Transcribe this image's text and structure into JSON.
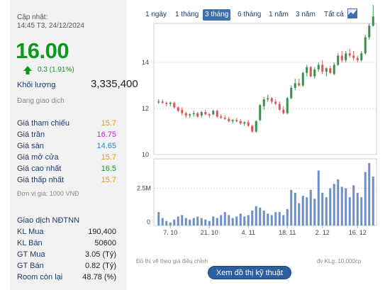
{
  "update": {
    "label": "Cập nhật:",
    "time": "14:45 T3, 24/12/2024"
  },
  "price": {
    "value": "16.00",
    "change": "0.3 (1.91%)",
    "color": "#0a9a1e"
  },
  "volume": {
    "label": "Khối lượng",
    "value": "3,335,400"
  },
  "status": "Đang giao dịch",
  "price_info": [
    {
      "label": "Giá tham chiếu",
      "value": "15.7",
      "color": "#e39a10"
    },
    {
      "label": "Giá trần",
      "value": "16.75",
      "color": "#d81ad8"
    },
    {
      "label": "Giá sàn",
      "value": "14.65",
      "color": "#1c8bd6"
    },
    {
      "label": "Giá mở cửa",
      "value": "15.7",
      "color": "#e39a10"
    },
    {
      "label": "Giá cao nhất",
      "value": "16.5",
      "color": "#0a9a1e"
    },
    {
      "label": "Giá thấp nhất",
      "value": "15.7",
      "color": "#e39a10"
    }
  ],
  "unit_note": "Đơn vị giá: 1000 VNĐ",
  "foreign": {
    "title": "Giao dịch NĐTNN",
    "rows": [
      {
        "label": "KL Mua",
        "value": "190,400"
      },
      {
        "label": "KL Bán",
        "value": "50600"
      },
      {
        "label": "GT Mua",
        "value": "3.05 (Tỷ)"
      },
      {
        "label": "GT Bán",
        "value": "0.82 (Tỷ)"
      },
      {
        "label": "Room còn lại",
        "value": "48.78 (%)"
      }
    ]
  },
  "tabs": [
    {
      "label": "1 ngày",
      "active": false
    },
    {
      "label": "1 tháng",
      "active": false
    },
    {
      "label": "3 tháng",
      "active": true
    },
    {
      "label": "6 tháng",
      "active": false
    },
    {
      "label": "1 năm",
      "active": false
    },
    {
      "label": "3 năm",
      "active": false
    },
    {
      "label": "Tất cả",
      "active": false
    }
  ],
  "chart_icon": "line-chart-icon",
  "footer": {
    "left_note": "Đồ thị vẽ theo giá điều chỉnh",
    "right_note": "đv KLg: 10,000cp",
    "button": "Xem đồ thị kỹ thuật"
  },
  "chart_data": {
    "type": "candlestick",
    "up_color": "#3a8f4d",
    "down_color": "#e05555",
    "price_axis": {
      "ticks": [
        10,
        12,
        14
      ],
      "range": [
        10,
        15.7
      ]
    },
    "volume_axis": {
      "ticks": [
        "0",
        "2.5M"
      ],
      "range": [
        0,
        4.2
      ]
    },
    "x_ticks": [
      "7. 10",
      "21. 10",
      "4. 11",
      "18. 11",
      "2. 12",
      "16. 12"
    ],
    "candles": [
      [
        12.3,
        12.4,
        12.2,
        12.3,
        0.9
      ],
      [
        12.3,
        12.4,
        12.2,
        12.25,
        0.5
      ],
      [
        12.25,
        12.3,
        12.1,
        12.2,
        0.3
      ],
      [
        12.2,
        12.3,
        12.1,
        12.25,
        0.2
      ],
      [
        12.25,
        12.3,
        12.0,
        12.05,
        0.4
      ],
      [
        12.05,
        12.1,
        11.85,
        11.9,
        0.6
      ],
      [
        11.95,
        12.05,
        11.7,
        11.8,
        0.7
      ],
      [
        11.8,
        11.85,
        11.6,
        11.7,
        0.5
      ],
      [
        11.7,
        11.8,
        11.6,
        11.75,
        0.4
      ],
      [
        11.75,
        11.9,
        11.65,
        11.8,
        0.5
      ],
      [
        11.8,
        11.85,
        11.6,
        11.65,
        0.6
      ],
      [
        11.7,
        11.9,
        11.6,
        11.85,
        0.5
      ],
      [
        11.85,
        11.95,
        11.7,
        11.75,
        0.4
      ],
      [
        11.75,
        11.8,
        11.6,
        11.7,
        0.3
      ],
      [
        11.75,
        11.95,
        11.7,
        11.9,
        0.6
      ],
      [
        11.9,
        11.95,
        11.6,
        11.65,
        0.5
      ],
      [
        11.65,
        11.75,
        11.55,
        11.6,
        0.7
      ],
      [
        11.6,
        11.7,
        11.5,
        11.55,
        0.9
      ],
      [
        11.55,
        11.65,
        11.4,
        11.45,
        0.7
      ],
      [
        11.45,
        11.55,
        11.35,
        11.5,
        0.5
      ],
      [
        11.5,
        11.6,
        11.4,
        11.45,
        0.6
      ],
      [
        11.45,
        11.55,
        11.3,
        11.35,
        0.8
      ],
      [
        11.35,
        11.45,
        11.25,
        11.4,
        0.6
      ],
      [
        11.4,
        11.5,
        11.2,
        11.25,
        0.7
      ],
      [
        11.25,
        11.3,
        10.95,
        11.0,
        1.0
      ],
      [
        11.0,
        11.5,
        10.95,
        11.45,
        1.3
      ],
      [
        11.5,
        12.2,
        11.45,
        12.15,
        1.2
      ],
      [
        12.1,
        12.5,
        11.95,
        12.4,
        1.0
      ],
      [
        12.4,
        12.6,
        12.3,
        12.45,
        0.8
      ],
      [
        12.45,
        12.5,
        12.2,
        12.3,
        0.7
      ],
      [
        12.3,
        12.4,
        12.15,
        12.2,
        0.9
      ],
      [
        12.2,
        12.3,
        11.9,
        11.95,
        0.9
      ],
      [
        11.95,
        12.1,
        11.75,
        11.8,
        0.7
      ],
      [
        11.8,
        12.5,
        11.75,
        12.45,
        1.1
      ],
      [
        12.45,
        13.0,
        12.4,
        12.9,
        2.4
      ],
      [
        12.9,
        13.3,
        12.8,
        13.1,
        2.2
      ],
      [
        13.1,
        13.3,
        12.95,
        13.0,
        1.5
      ],
      [
        13.0,
        13.6,
        12.95,
        13.55,
        2.0
      ],
      [
        13.55,
        13.9,
        13.4,
        13.8,
        1.9
      ],
      [
        13.8,
        13.85,
        13.35,
        13.4,
        2.4
      ],
      [
        13.4,
        13.8,
        13.3,
        13.7,
        1.8
      ],
      [
        13.7,
        14.0,
        13.6,
        13.9,
        3.7
      ],
      [
        13.9,
        14.1,
        13.5,
        13.6,
        2.2
      ],
      [
        13.6,
        13.8,
        13.4,
        13.75,
        1.9
      ],
      [
        13.75,
        13.85,
        13.5,
        13.55,
        2.5
      ],
      [
        13.5,
        14.0,
        13.45,
        13.9,
        2.8
      ],
      [
        13.9,
        14.4,
        13.85,
        14.3,
        3.1
      ],
      [
        14.3,
        14.5,
        14.0,
        14.1,
        2.6
      ],
      [
        14.1,
        14.5,
        14.0,
        14.4,
        2.5
      ],
      [
        14.4,
        14.6,
        14.2,
        14.3,
        1.9
      ],
      [
        14.3,
        14.5,
        14.1,
        14.2,
        2.7
      ],
      [
        14.2,
        14.3,
        14.0,
        14.1,
        2.2
      ],
      [
        14.1,
        14.5,
        14.05,
        14.4,
        1.9
      ],
      [
        14.4,
        15.2,
        14.35,
        15.1,
        3.6
      ],
      [
        15.1,
        15.7,
        15.0,
        15.6,
        4.2
      ],
      [
        15.6,
        16.5,
        15.55,
        16.0,
        3.3
      ]
    ]
  }
}
